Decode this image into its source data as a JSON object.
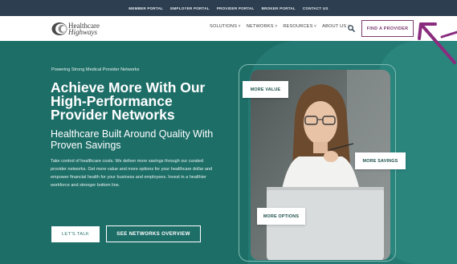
{
  "topbar": {
    "links": [
      "MEMBER PORTAL",
      "EMPLOYER PORTAL",
      "PROVIDER PORTAL",
      "BROKER PORTAL",
      "CONTACT US"
    ]
  },
  "logo": {
    "line1": "Healthcare",
    "line2": "Highways",
    "mark_color": "#4a4a4a"
  },
  "nav": {
    "items": [
      {
        "label": "SOLUTIONS",
        "icon": "chevron-down-icon"
      },
      {
        "label": "NETWORKS",
        "icon": "chevron-down-icon"
      },
      {
        "label": "RESOURCES",
        "icon": "chevron-down-icon"
      },
      {
        "label": "ABOUT US",
        "icon": "chevron-down-icon"
      }
    ],
    "search_icon": "search-icon",
    "cta_label": "FIND A PROVIDER"
  },
  "hero": {
    "eyebrow": "Powering Strong Medical Provider Networks",
    "headline": "Achieve More With Our High-Performance Provider Networks",
    "subhead": "Healthcare Built Around Quality With Proven Savings",
    "body": "Take control of healthcare costs. We deliver more savings through our curated provider networks. Get more value and more options for your healthcare dollar and empower financial health for your business and employees. Invest in a healthier workforce and stronger bottom line.",
    "primary_button": "LET'S TALK",
    "secondary_button": "SEE NETWORKS OVERVIEW",
    "badges": {
      "value": "MORE VALUE",
      "savings": "MORE SAVINGS",
      "options": "MORE OPTIONS"
    }
  },
  "colors": {
    "topbar_bg": "#2c3e50",
    "hero_bg": "#1e6e68",
    "accent_purple": "#7a3b6e",
    "arrow": "#8a2c7e"
  }
}
